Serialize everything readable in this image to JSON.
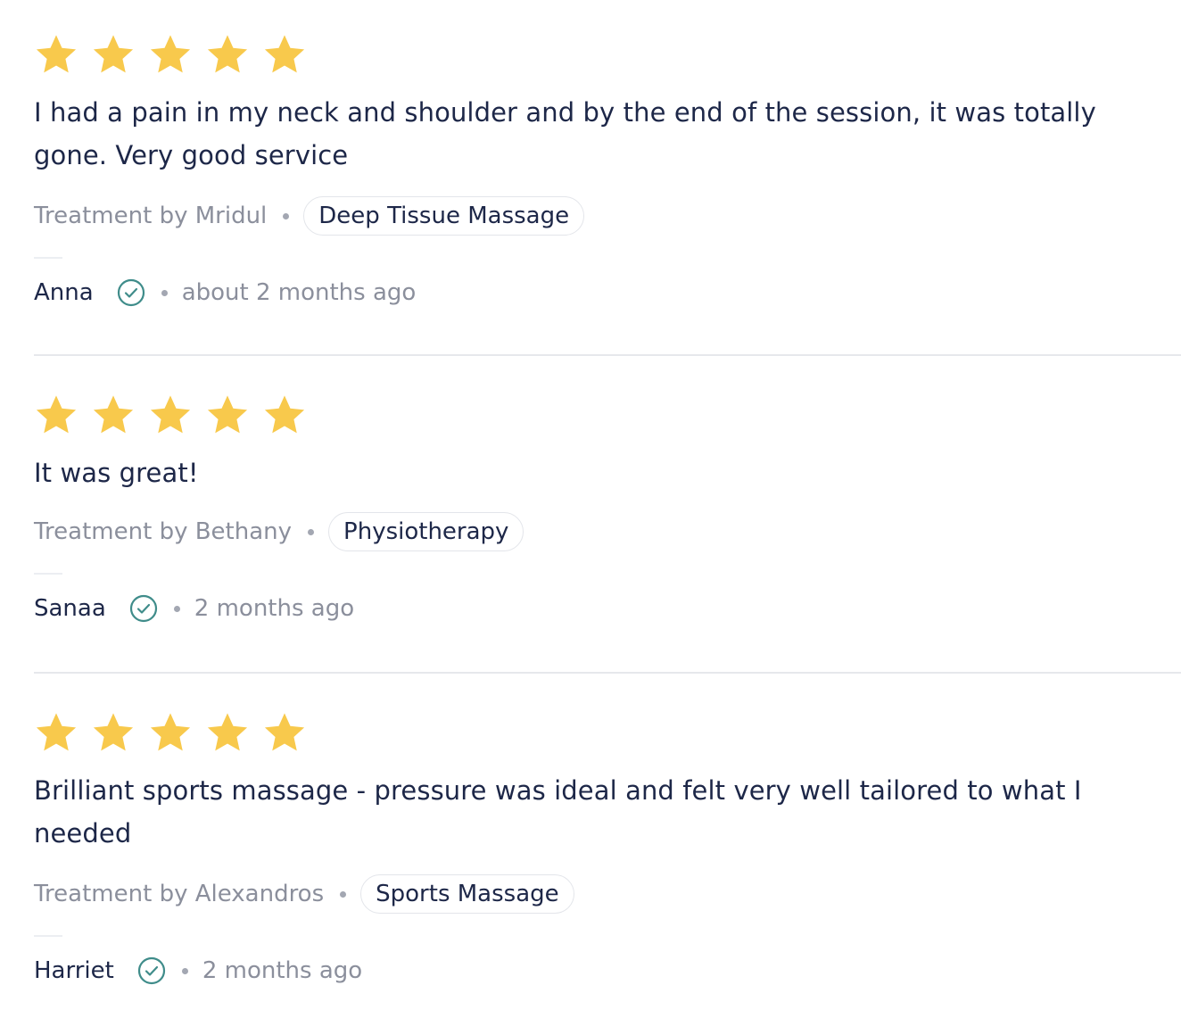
{
  "colors": {
    "star": "#f8c94c",
    "text": "#1d2748",
    "muted": "#8b8f9c",
    "verified": "#3f8c8a",
    "divider": "#e6e8ec"
  },
  "reviews": [
    {
      "rating": 5,
      "text": "I had a pain in my neck and shoulder and by the end of the session, it was totally gone. Very good service",
      "treatment_by": "Treatment by Mridul",
      "treatment_tag": "Deep Tissue Massage",
      "author": "Anna",
      "verified_icon": "check-circle-icon",
      "time": "about 2 months ago"
    },
    {
      "rating": 5,
      "text": "It was great!",
      "treatment_by": "Treatment by Bethany",
      "treatment_tag": "Physiotherapy",
      "author": "Sanaa",
      "verified_icon": "check-circle-icon",
      "time": "2 months ago"
    },
    {
      "rating": 5,
      "text": "Brilliant sports massage - pressure was ideal and felt very well tailored to what I needed",
      "treatment_by": "Treatment by Alexandros",
      "treatment_tag": "Sports Massage",
      "author": "Harriet",
      "verified_icon": "check-circle-icon",
      "time": "2 months ago"
    }
  ]
}
